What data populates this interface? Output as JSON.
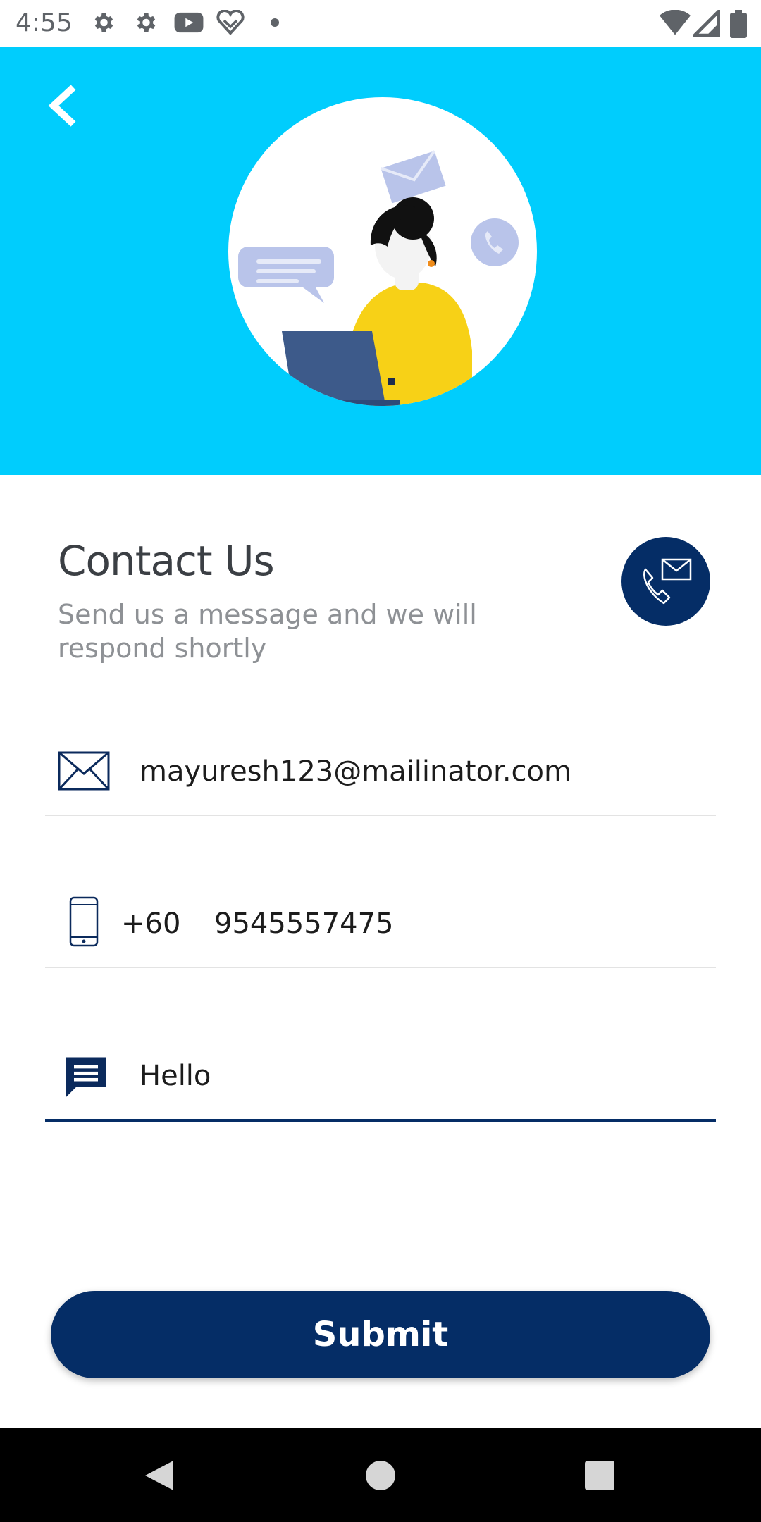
{
  "status_bar": {
    "time": "4:55",
    "left_icons": [
      "settings-icon",
      "settings-icon",
      "youtube-icon",
      "heart-icon",
      "dot-icon"
    ],
    "right_icons": [
      "wifi-icon",
      "signal-icon",
      "battery-icon"
    ]
  },
  "header": {
    "background": "#00cdfd",
    "back_icon": "chevron-left-icon",
    "illustration": "person-at-laptop-with-chat-mail-phone-bubbles"
  },
  "contact": {
    "title": "Contact Us",
    "subtitle": "Send us a message and we will respond shortly",
    "badge_icon": "phone-mail-icon"
  },
  "form": {
    "email": {
      "icon": "envelope-icon",
      "value": "mayuresh123@mailinator.com"
    },
    "phone": {
      "icon": "mobile-phone-icon",
      "country_code": "+60",
      "value": "9545557475"
    },
    "message": {
      "icon": "message-icon",
      "value": "Hello"
    },
    "submit_label": "Submit"
  },
  "colors": {
    "accent": "#052d66",
    "header": "#00cdfd",
    "title": "#3b3f44",
    "subtitle": "#8e9195"
  },
  "nav_bar": {
    "icons": [
      "back-triangle-icon",
      "home-circle-icon",
      "recents-square-icon"
    ]
  }
}
